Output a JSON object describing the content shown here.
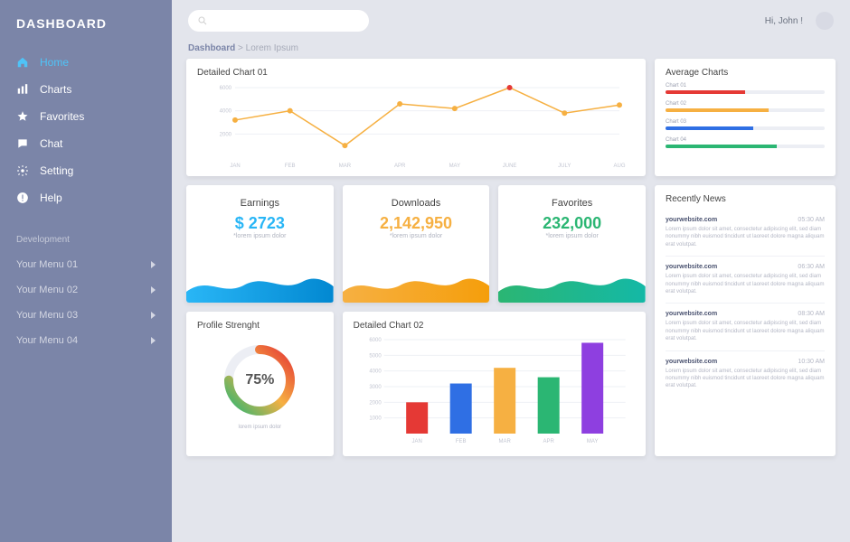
{
  "app": {
    "title": "DASHBOARD"
  },
  "nav": {
    "items": [
      {
        "label": "Home",
        "icon": "home",
        "active": true
      },
      {
        "label": "Charts",
        "icon": "bars"
      },
      {
        "label": "Favorites",
        "icon": "star"
      },
      {
        "label": "Chat",
        "icon": "chat"
      },
      {
        "label": "Setting",
        "icon": "gear"
      },
      {
        "label": "Help",
        "icon": "alert"
      }
    ],
    "dev_label": "Development",
    "dev_items": [
      "Your Menu 01",
      "Your Menu 02",
      "Your Menu 03",
      "Your Menu 04"
    ]
  },
  "header": {
    "greeting": "Hi, John !",
    "breadcrumb": {
      "root": "Dashboard",
      "sep": ">",
      "current": "Lorem Ipsum"
    }
  },
  "chart_data": [
    {
      "id": "detailed_01",
      "type": "line",
      "title": "Detailed Chart 01",
      "categories": [
        "JAN",
        "FEB",
        "MAR",
        "APR",
        "MAY",
        "JUNE",
        "JULY",
        "AUG"
      ],
      "values": [
        3200,
        4000,
        1000,
        4600,
        4200,
        6000,
        3800,
        4500
      ],
      "ylim": [
        0,
        6000
      ],
      "yticks": [
        2000,
        4000,
        6000
      ],
      "highlight_index": 5,
      "highlight_color": "#e53935",
      "line_color": "#f6b042"
    },
    {
      "id": "avg_charts",
      "type": "bar",
      "title": "Average Charts",
      "series": [
        {
          "name": "Chart 01",
          "value": 50,
          "color": "#e53935"
        },
        {
          "name": "Chart 02",
          "value": 65,
          "color": "#f6b042"
        },
        {
          "name": "Chart 03",
          "value": 55,
          "color": "#2f6fe4"
        },
        {
          "name": "Chart 04",
          "value": 70,
          "color": "#2bb673"
        }
      ],
      "xlim": [
        0,
        100
      ]
    },
    {
      "id": "profile_strength",
      "type": "pie",
      "title": "Profile Strenght",
      "value": 75,
      "sub": "lorem ipsum dolor",
      "colors": [
        "#2bb673",
        "#f6b042",
        "#e53935"
      ]
    },
    {
      "id": "detailed_02",
      "type": "bar",
      "title": "Detailed Chart 02",
      "categories": [
        "JAN",
        "FEB",
        "MAR",
        "APR",
        "MAY"
      ],
      "values": [
        2000,
        3200,
        4200,
        3600,
        5800
      ],
      "colors": [
        "#e53935",
        "#2f6fe4",
        "#f6b042",
        "#2bb673",
        "#8e3fe0"
      ],
      "ylim": [
        0,
        6000
      ],
      "yticks": [
        1000,
        2000,
        3000,
        4000,
        5000,
        6000
      ]
    }
  ],
  "stats": [
    {
      "title": "Earnings",
      "value": "$ 2723",
      "sub": "*lorem ipsum dolor",
      "color": "#29b6f6",
      "grad2": "#0288d1"
    },
    {
      "title": "Downloads",
      "value": "2,142,950",
      "sub": "*lorem ipsum dolor",
      "color": "#f6b042",
      "grad2": "#f59e0b"
    },
    {
      "title": "Favorites",
      "value": "232,000",
      "sub": "*lorem ipsum dolor",
      "color": "#2bb673",
      "grad2": "#14b8a6"
    }
  ],
  "news": {
    "title": "Recently News",
    "items": [
      {
        "src": "yourwebsite.com",
        "time": "05:30 AM",
        "body": "Lorem ipsum dolor sit amet, consectetur adipiscing elit, sed diam nonummy nibh euismod tincidunt ut laoreet dolore magna aliquam erat volutpat."
      },
      {
        "src": "yourwebsite.com",
        "time": "06:30 AM",
        "body": "Lorem ipsum dolor sit amet, consectetur adipiscing elit, sed diam nonummy nibh euismod tincidunt ut laoreet dolore magna aliquam erat volutpat."
      },
      {
        "src": "yourwebsite.com",
        "time": "08:30 AM",
        "body": "Lorem ipsum dolor sit amet, consectetur adipiscing elit, sed diam nonummy nibh euismod tincidunt ut laoreet dolore magna aliquam erat volutpat."
      },
      {
        "src": "yourwebsite.com",
        "time": "10:30 AM",
        "body": "Lorem ipsum dolor sit amet, consectetur adipiscing elit, sed diam nonummy nibh euismod tincidunt ut laoreet dolore magna aliquam erat volutpat."
      }
    ]
  }
}
